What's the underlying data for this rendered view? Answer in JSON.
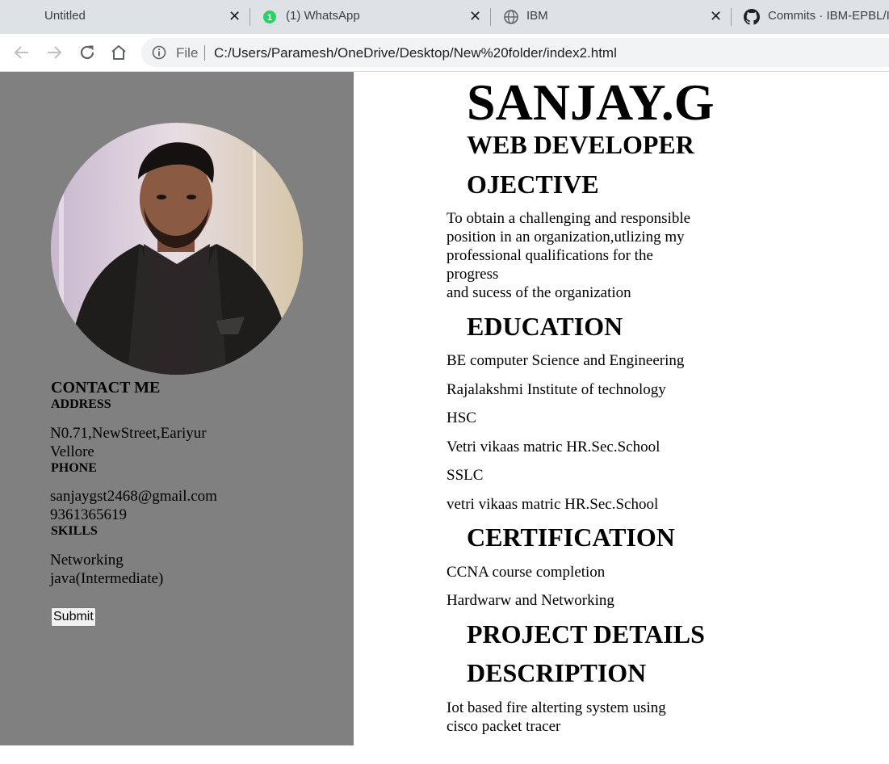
{
  "browser": {
    "tabs": [
      {
        "title": "Untitled",
        "icon": "none"
      },
      {
        "title": "(1) WhatsApp",
        "icon": "whatsapp-icon",
        "badge": "1"
      },
      {
        "title": "IBM",
        "icon": "globe-icon"
      },
      {
        "title": "Commits · IBM-EPBL/IB",
        "icon": "github-icon"
      }
    ],
    "close_glyph": "✕",
    "address": {
      "scheme_label": "File",
      "url": "C:/Users/Paramesh/OneDrive/Desktop/New%20folder/index2.html"
    }
  },
  "sidebar": {
    "contact_heading": "CONTACT ME",
    "address_heading": "ADDRESS",
    "address_lines": [
      "N0.71,NewStreet,Eariyur",
      "Vellore"
    ],
    "phone_heading": "PHONE",
    "phone_lines": [
      "sanjaygst2468@gmail.com",
      "9361365619"
    ],
    "skills_heading": "SKILLS",
    "skills_lines": [
      "Networking",
      "java(Intermediate)"
    ],
    "submit_label": "Submit"
  },
  "resume": {
    "name": "SANJAY.G",
    "role": "WEB DEVELOPER",
    "objective_heading": "OJECTIVE",
    "objective_lines": [
      "To obtain a challenging and responsible",
      "position in an organization,utlizing my",
      "professional qualifications for the",
      "progress",
      "and sucess of the organization"
    ],
    "education_heading": "EDUCATION",
    "education_items": [
      "BE computer Science and Engineering",
      "Rajalakshmi Institute of technology",
      "HSC",
      "Vetri vikaas matric HR.Sec.School",
      "SSLC",
      "vetri vikaas matric HR.Sec.School"
    ],
    "certification_heading": "CERTIFICATION",
    "certification_items": [
      "CCNA course completion",
      "Hardwarw and Networking"
    ],
    "project_heading": "PROJECT DETAILS",
    "description_heading": "DESCRIPTION",
    "description_lines": [
      "Iot based fire alterting system using",
      "cisco packet tracer"
    ]
  },
  "colors": {
    "sidebar_bg": "#808080",
    "tabbar_bg": "#dee1e6",
    "whatsapp_green": "#25d366"
  }
}
